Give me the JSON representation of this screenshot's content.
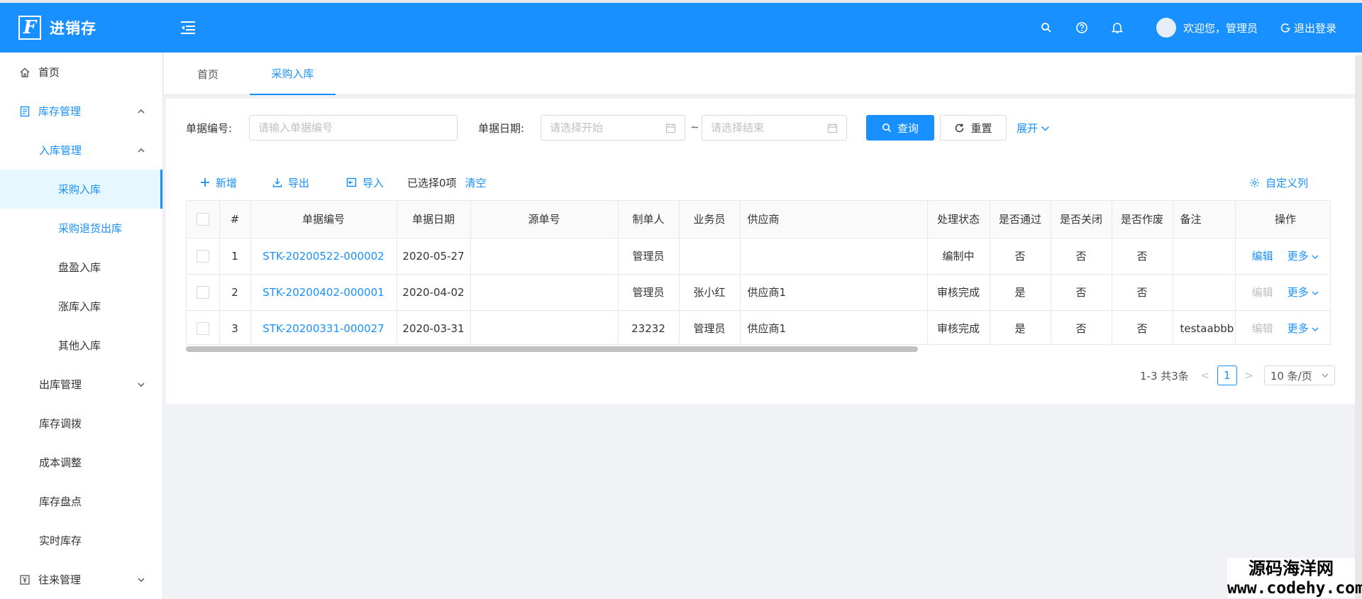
{
  "app": {
    "logo_letter": "F",
    "title": "进销存"
  },
  "header": {
    "user_name": "欢迎您，管理员",
    "logout_label": "退出登录"
  },
  "sidebar": {
    "items": [
      {
        "label": "首页"
      },
      {
        "label": "库存管理"
      },
      {
        "label": "入库管理"
      },
      {
        "label": "采购入库"
      },
      {
        "label": "采购退货出库"
      },
      {
        "label": "盘盈入库"
      },
      {
        "label": "涨库入库"
      },
      {
        "label": "其他入库"
      },
      {
        "label": "出库管理"
      },
      {
        "label": "库存调拨"
      },
      {
        "label": "成本调整"
      },
      {
        "label": "库存盘点"
      },
      {
        "label": "实时库存"
      },
      {
        "label": "往来管理"
      }
    ]
  },
  "tabs": [
    {
      "label": "首页"
    },
    {
      "label": "采购入库"
    }
  ],
  "search": {
    "doc_no_label": "单据编号:",
    "doc_no_placeholder": "请输入单据编号",
    "date_label": "单据日期:",
    "date_start_placeholder": "请选择开始",
    "date_sep": "~",
    "date_end_placeholder": "请选择结束",
    "query_label": "查询",
    "reset_label": "重置",
    "expand_label": "展开"
  },
  "toolbar": {
    "add_label": "新增",
    "export_label": "导出",
    "import_label": "导入",
    "selected_text": "已选择0项",
    "clear_label": "清空",
    "custom_columns_label": "自定义列"
  },
  "table": {
    "headers": [
      "#",
      "单据编号",
      "单据日期",
      "源单号",
      "制单人",
      "业务员",
      "供应商",
      "处理状态",
      "是否通过",
      "是否关闭",
      "是否作废",
      "备注",
      "操作"
    ],
    "rows": [
      {
        "idx": "1",
        "doc_no": "STK-20200522-000002",
        "date": "2020-05-27",
        "src": "",
        "creator": "管理员",
        "salesman": "",
        "supplier": "",
        "status": "编制中",
        "passed": "否",
        "closed": "否",
        "voided": "否",
        "remark": "",
        "edit": "编辑",
        "more": "更多"
      },
      {
        "idx": "2",
        "doc_no": "STK-20200402-000001",
        "date": "2020-04-02",
        "src": "",
        "creator": "管理员",
        "salesman": "张小红",
        "supplier": "供应商1",
        "status": "审核完成",
        "passed": "是",
        "closed": "否",
        "voided": "否",
        "remark": "",
        "edit": "编辑",
        "more": "更多"
      },
      {
        "idx": "3",
        "doc_no": "STK-20200331-000027",
        "date": "2020-03-31",
        "src": "",
        "creator": "23232",
        "salesman": "管理员",
        "supplier": "供应商1",
        "status": "审核完成",
        "passed": "是",
        "closed": "否",
        "voided": "否",
        "remark": "testaabbb",
        "edit": "编辑",
        "more": "更多"
      }
    ]
  },
  "pagination": {
    "total_text": "1-3 共3条",
    "current_page": "1",
    "page_size": "10 条/页",
    "prev": "<",
    "next": ">"
  },
  "watermark": {
    "line1": "源码海洋网",
    "line2": "www.codehy.com"
  },
  "colors": {
    "primary": "#1890ff",
    "header_bg": "#1890ff",
    "page_bg": "#f0f2f5"
  }
}
